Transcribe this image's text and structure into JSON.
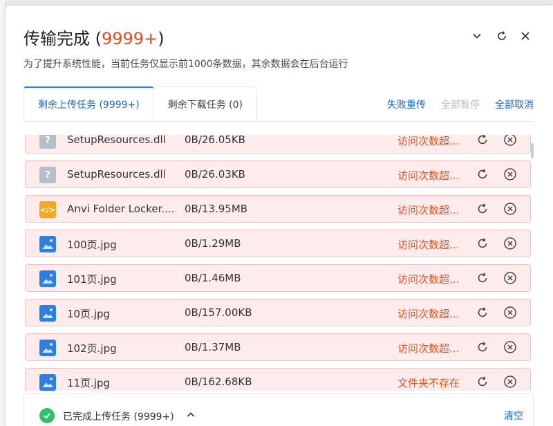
{
  "dialog": {
    "title": "传输完成 (",
    "title_count": "9999+",
    "title_close": ")",
    "subtitle": "为了提升系统性能，当前任务仅显示前1000条数据，其余数据会在后台运行"
  },
  "header_icons": [
    "chevron-down-icon",
    "refresh-icon",
    "close-icon"
  ],
  "tabs": [
    {
      "label": "剩余上传任务 (9999+)",
      "active": true
    },
    {
      "label": "剩余下载任务 (0)",
      "active": false
    }
  ],
  "actions": {
    "retry_failed": "失败重传",
    "pause_all": "全部暂停",
    "cancel_all": "全部取消"
  },
  "tasks": [
    {
      "name": "SetupResources.dll",
      "size": "0B/26.05KB",
      "status": "访问次数超...",
      "icon": "unknown-file-icon"
    },
    {
      "name": "SetupResources.dll",
      "size": "0B/26.03KB",
      "status": "访问次数超...",
      "icon": "unknown-file-icon"
    },
    {
      "name": "Anvi Folder Locker....",
      "size": "0B/13.95MB",
      "status": "访问次数超...",
      "icon": "code-file-icon"
    },
    {
      "name": "100页.jpg",
      "size": "0B/1.29MB",
      "status": "访问次数超...",
      "icon": "image-file-icon"
    },
    {
      "name": "101页.jpg",
      "size": "0B/1.46MB",
      "status": "访问次数超...",
      "icon": "image-file-icon"
    },
    {
      "name": "10页.jpg",
      "size": "0B/157.00KB",
      "status": "访问次数超...",
      "icon": "image-file-icon"
    },
    {
      "name": "102页.jpg",
      "size": "0B/1.37MB",
      "status": "访问次数超...",
      "icon": "image-file-icon"
    },
    {
      "name": "11页.jpg",
      "size": "0B/162.68KB",
      "status": "文件夹不存在",
      "icon": "image-file-icon"
    }
  ],
  "footer": {
    "label": "已完成上传任务 (9999+)",
    "clear": "清空"
  },
  "colors": {
    "accent": "#1a66c9",
    "error": "#e5501d",
    "row_bg": "#fdeceb",
    "success": "#2ec26b"
  }
}
